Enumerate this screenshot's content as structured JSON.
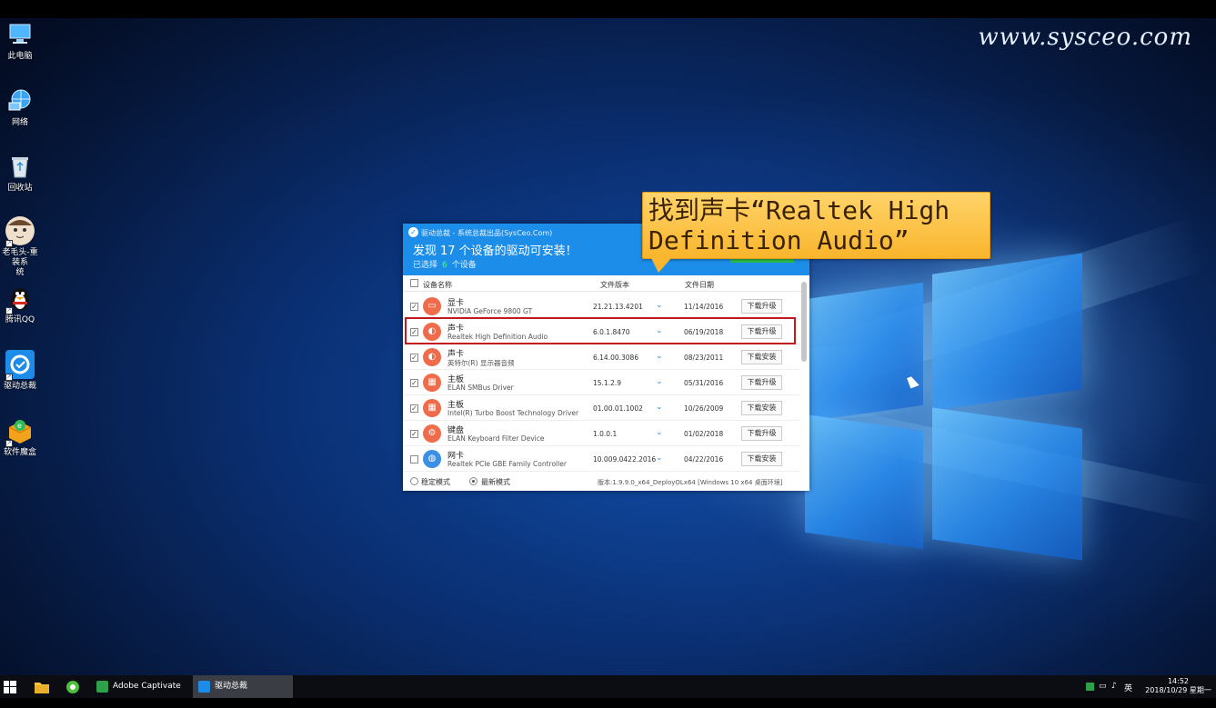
{
  "watermark": "www.sysceo.com",
  "desktop_icons": [
    {
      "label": "此电脑",
      "icon": "computer-icon"
    },
    {
      "label": "网络",
      "icon": "network-icon"
    },
    {
      "label": "回收站",
      "icon": "recycle-bin-icon"
    },
    {
      "label_line1": "老毛头-重装系",
      "label_line2": "统",
      "icon": "reinstall-icon"
    },
    {
      "label": "腾讯QQ",
      "icon": "qq-penguin-icon"
    },
    {
      "label": "驱动总裁",
      "icon": "driver-icon"
    },
    {
      "label": "软件魔盒",
      "icon": "software-box-icon"
    }
  ],
  "app": {
    "title": "驱动总裁 - 系统总裁出品(SysCeo.Com)",
    "headline_prefix": "发现",
    "headline_count": "17",
    "headline_suffix": "个设备的驱动可安装！",
    "selected_prefix": "已选择",
    "selected_count": "6",
    "selected_suffix": "个设备",
    "columns": {
      "name": "设备名称",
      "version": "文件版本",
      "date": "文件日期"
    },
    "rows": [
      {
        "category": "显卡",
        "device": "NVIDIA GeForce 9800 GT",
        "version": "21.21.13.4201",
        "date": "11/14/2016",
        "action": "下载升级",
        "checked": true,
        "icon": "display-icon"
      },
      {
        "category": "声卡",
        "device": "Realtek High Definition Audio",
        "version": "6.0.1.8470",
        "date": "06/19/2018",
        "action": "下载升级",
        "checked": true,
        "icon": "speaker-icon"
      },
      {
        "category": "声卡",
        "device": "英特尔(R) 显示器音频",
        "version": "6.14.00.3086",
        "date": "08/23/2011",
        "action": "下载安装",
        "checked": true,
        "icon": "speaker-icon"
      },
      {
        "category": "主板",
        "device": "ELAN SMBus Driver",
        "version": "15.1.2.9",
        "date": "05/31/2016",
        "action": "下载升级",
        "checked": true,
        "icon": "board-icon"
      },
      {
        "category": "主板",
        "device": "Intel(R) Turbo Boost Technology Driver",
        "version": "01.00.01.1002",
        "date": "10/26/2009",
        "action": "下载安装",
        "checked": true,
        "icon": "board-icon"
      },
      {
        "category": "键盘",
        "device": "ELAN Keyboard Filter Device",
        "version": "1.0.0.1",
        "date": "01/02/2018",
        "action": "下载升级",
        "checked": true,
        "icon": "gear-icon"
      },
      {
        "category": "网卡",
        "device": "Realtek PCIe GBE Family Controller",
        "version": "10.009.0422.2016",
        "date": "04/22/2016",
        "action": "下载安装",
        "checked": false,
        "icon": "globe-icon"
      }
    ],
    "mode_stable": "稳定模式",
    "mode_latest": "最新模式",
    "version_info": "版本:1.9.9.0_x64_DeployOLx64 [Windows 10 x64 桌面环境]"
  },
  "callout": {
    "text": "找到声卡“Realtek High\nDefinition Audio”"
  },
  "taskbar": {
    "apps": [
      {
        "label": "Adobe Captivate"
      },
      {
        "label": "驱动总裁"
      }
    ],
    "tray_lang": "英",
    "time": "14:52",
    "date": "2018/10/29 星期一"
  },
  "colors": {
    "accent": "#1c8de8",
    "highlight": "#c0191e",
    "callout": "#f9b52c"
  }
}
